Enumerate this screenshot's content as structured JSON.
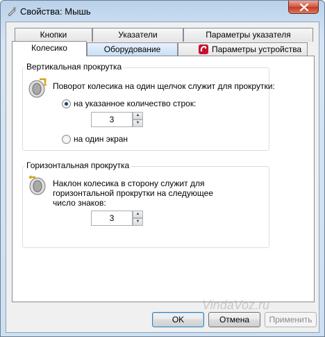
{
  "window": {
    "title": "Свойства: Мышь"
  },
  "tabs": {
    "row1": [
      {
        "label": "Кнопки"
      },
      {
        "label": "Указатели"
      },
      {
        "label": "Параметры указателя"
      }
    ],
    "row2": [
      {
        "label": "Колесико"
      },
      {
        "label": "Оборудование"
      },
      {
        "label": "Параметры устройства"
      }
    ]
  },
  "vertical": {
    "group_label": "Вертикальная прокрутка",
    "description": "Поворот колесика на один щелчок служит для прокрутки:",
    "option_lines_label": "на указанное количество строк:",
    "lines_value": "3",
    "option_screen_label": "на один экран"
  },
  "horizontal": {
    "group_label": "Горизонтальная прокрутка",
    "description_line1": "Наклон колесика в сторону служит для",
    "description_line2": "горизонтальной прокрутки на следующее",
    "description_line3": "число знаков:",
    "chars_value": "3"
  },
  "buttons": {
    "ok": "OK",
    "cancel": "Отмена",
    "apply": "Применить"
  },
  "watermark": "VindaVoz.ru",
  "colors": {
    "accent": "#3c7fb1",
    "close": "#c23a22"
  }
}
